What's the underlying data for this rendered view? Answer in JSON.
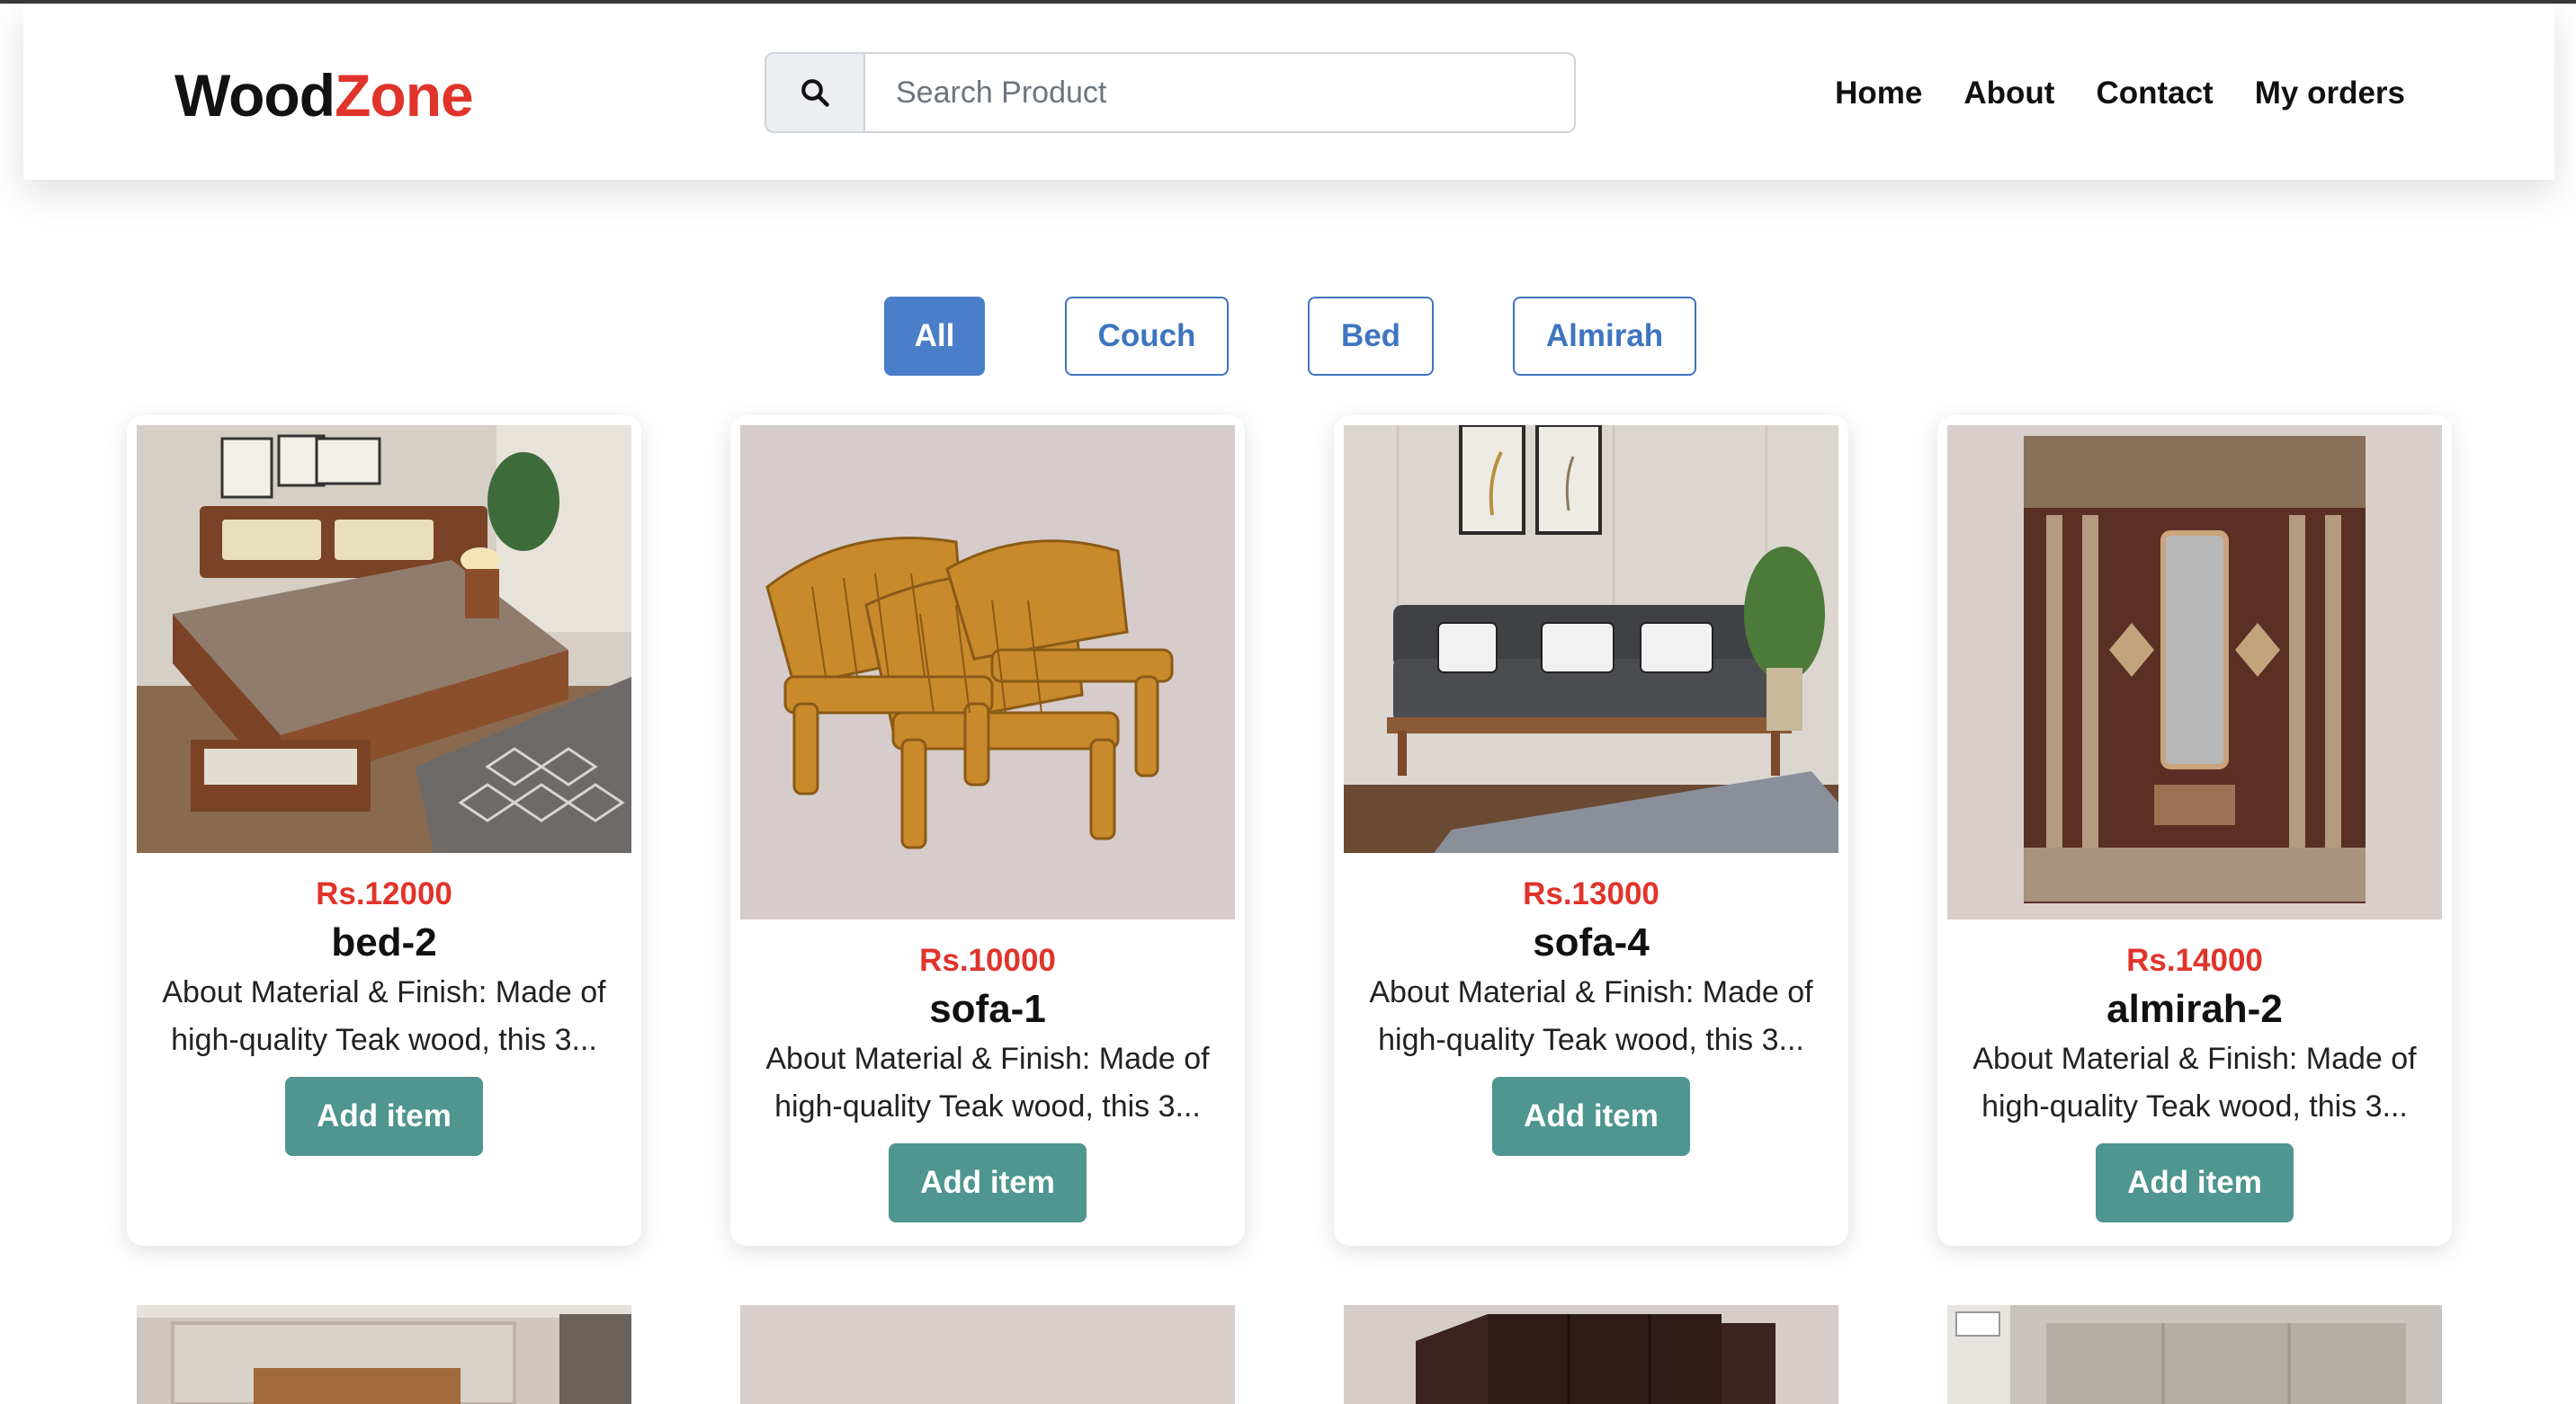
{
  "brand": {
    "part1": "Wood",
    "part2": "Zone"
  },
  "search": {
    "placeholder": "Search Product",
    "icon": "search-icon"
  },
  "nav": {
    "home": "Home",
    "about": "About",
    "contact": "Contact",
    "orders": "My orders"
  },
  "filters": {
    "all": "All",
    "couch": "Couch",
    "bed": "Bed",
    "almirah": "Almirah",
    "active": "All"
  },
  "colors": {
    "brand_accent": "#e0342b",
    "filter_blue": "#4a7ec9",
    "add_button": "#4f9590"
  },
  "products": [
    {
      "price": "Rs.12000",
      "name": "bed-2",
      "description": "About Material & Finish: Made of high-quality Teak wood, this 3...",
      "button": "Add item"
    },
    {
      "price": "Rs.10000",
      "name": "sofa-1",
      "description": "About Material & Finish: Made of high-quality Teak wood, this 3...",
      "button": "Add item"
    },
    {
      "price": "Rs.13000",
      "name": "sofa-4",
      "description": "About Material & Finish: Made of high-quality Teak wood, this 3...",
      "button": "Add item"
    },
    {
      "price": "Rs.14000",
      "name": "almirah-2",
      "description": "About Material & Finish: Made of high-quality Teak wood, this 3...",
      "button": "Add item"
    }
  ]
}
